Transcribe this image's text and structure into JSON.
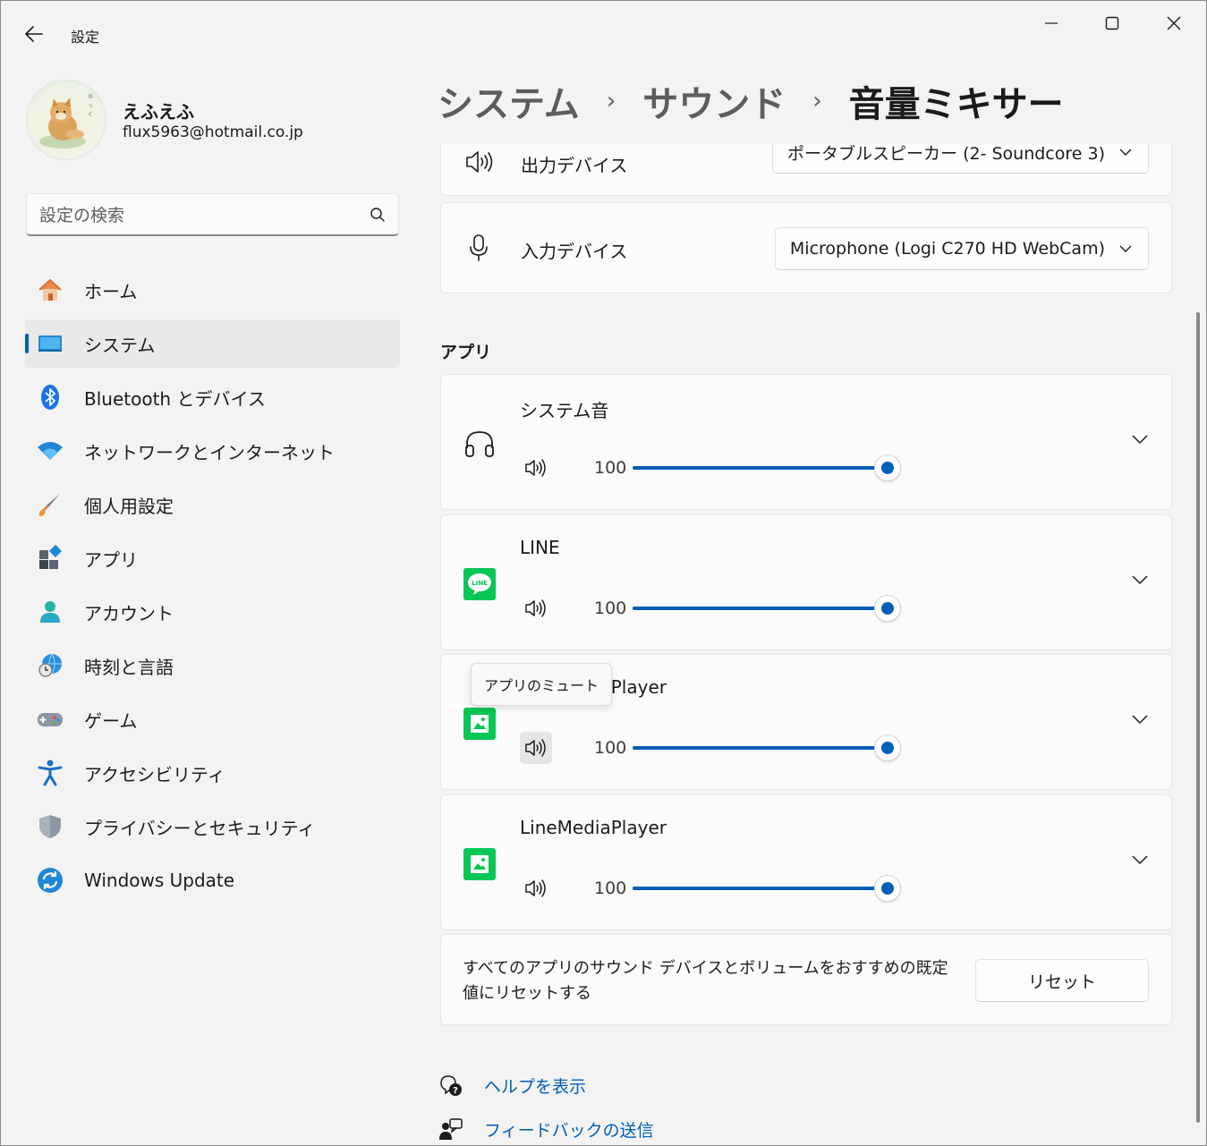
{
  "window": {
    "title": "設定",
    "controls": {
      "minimize": "minimize-icon",
      "maximize": "maximize-icon",
      "close": "close-icon"
    }
  },
  "user": {
    "name": "えふえふ",
    "email": "flux5963@hotmail.co.jp"
  },
  "search": {
    "placeholder": "設定の検索"
  },
  "sidebar": {
    "items": [
      {
        "label": "ホーム",
        "icon": "home-icon"
      },
      {
        "label": "システム",
        "icon": "system-icon",
        "active": true
      },
      {
        "label": "Bluetooth とデバイス",
        "icon": "bluetooth-icon"
      },
      {
        "label": "ネットワークとインターネット",
        "icon": "wifi-icon"
      },
      {
        "label": "個人用設定",
        "icon": "brush-icon"
      },
      {
        "label": "アプリ",
        "icon": "apps-icon"
      },
      {
        "label": "アカウント",
        "icon": "account-icon"
      },
      {
        "label": "時刻と言語",
        "icon": "time-language-icon"
      },
      {
        "label": "ゲーム",
        "icon": "gamepad-icon"
      },
      {
        "label": "アクセシビリティ",
        "icon": "accessibility-icon"
      },
      {
        "label": "プライバシーとセキュリティ",
        "icon": "shield-icon"
      },
      {
        "label": "Windows Update",
        "icon": "update-icon"
      }
    ]
  },
  "breadcrumb": {
    "level1": "システム",
    "level2": "サウンド",
    "current": "音量ミキサー",
    "separator": "›"
  },
  "devices": {
    "output": {
      "label": "出力デバイス",
      "value": "ポータブルスピーカー (2- Soundcore 3)"
    },
    "input": {
      "label": "入力デバイス",
      "value": "Microphone (Logi C270 HD WebCam)"
    }
  },
  "apps_section": {
    "title": "アプリ",
    "apps": [
      {
        "name": "システム音",
        "volume": "100",
        "icon": "headphones-icon"
      },
      {
        "name": "LINE",
        "volume": "100",
        "icon": "line-app-icon"
      },
      {
        "name": "LineMediaPlayer",
        "volume": "100",
        "icon": "media-player-icon"
      },
      {
        "name": "LineMediaPlayer",
        "volume": "100",
        "icon": "media-player-icon"
      }
    ],
    "tooltip": "アプリのミュート"
  },
  "reset": {
    "text": "すべてのアプリのサウンド デバイスとボリュームをおすすめの既定値にリセットする",
    "button": "リセット"
  },
  "links": {
    "help": "ヘルプを表示",
    "feedback": "フィードバックの送信"
  },
  "colors": {
    "accent": "#005fb8",
    "line_green": "#06c755"
  }
}
